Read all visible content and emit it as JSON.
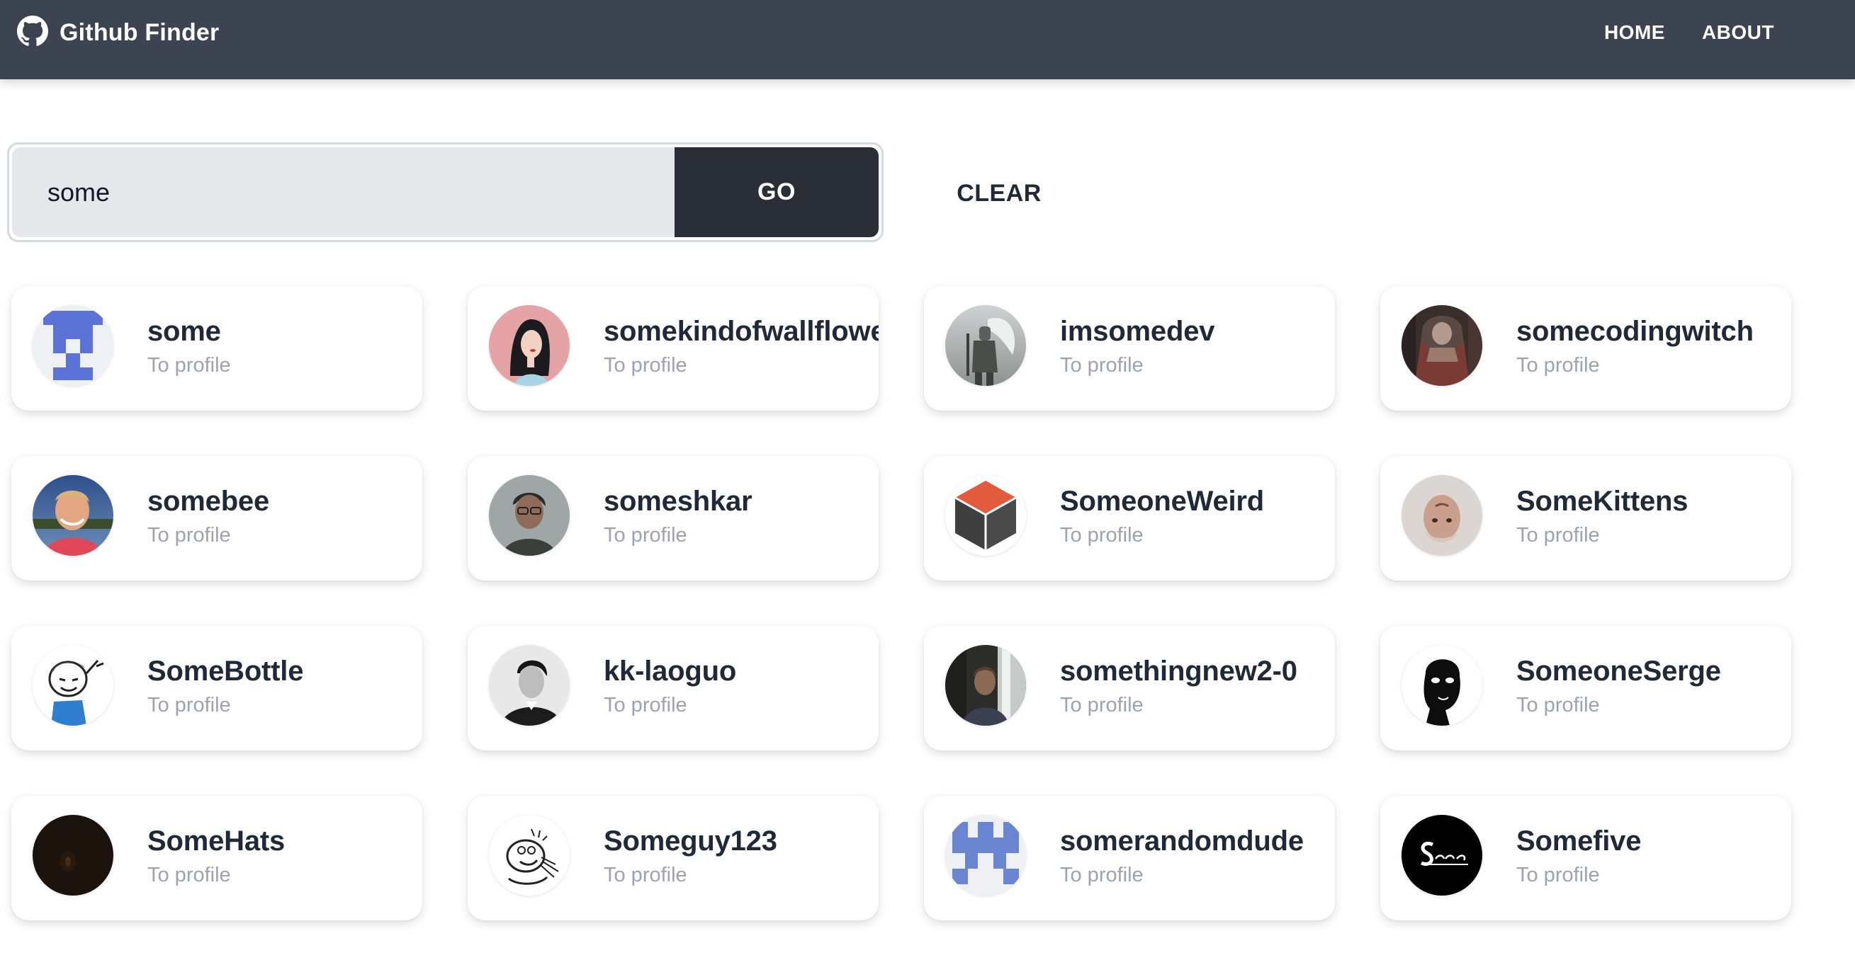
{
  "navbar": {
    "title": "Github Finder",
    "logo_icon": "github-icon",
    "links": [
      {
        "label": "HOME"
      },
      {
        "label": "ABOUT"
      }
    ],
    "background": "#3d4451"
  },
  "search": {
    "value": "some",
    "go_label": "GO",
    "clear_label": "CLEAR"
  },
  "results": [
    {
      "login": "some",
      "link": "To profile",
      "avatar": "identicon-blue"
    },
    {
      "login": "somekindofwallflower",
      "link": "To profile",
      "avatar": "illustrated-woman"
    },
    {
      "login": "imsomedev",
      "link": "To profile",
      "avatar": "knight-photo"
    },
    {
      "login": "somecodingwitch",
      "link": "To profile",
      "avatar": "figure-photo"
    },
    {
      "login": "somebee",
      "link": "To profile",
      "avatar": "smiling-man-photo"
    },
    {
      "login": "someshkar",
      "link": "To profile",
      "avatar": "man-glasses-photo"
    },
    {
      "login": "SomeoneWeird",
      "link": "To profile",
      "avatar": "cube-logo"
    },
    {
      "login": "SomeKittens",
      "link": "To profile",
      "avatar": "upside-down-face-photo"
    },
    {
      "login": "SomeBottle",
      "link": "To profile",
      "avatar": "cartoon-character"
    },
    {
      "login": "kk-laoguo",
      "link": "To profile",
      "avatar": "bw-portrait-photo"
    },
    {
      "login": "somethingnew2-0",
      "link": "To profile",
      "avatar": "waterfall-man-photo"
    },
    {
      "login": "SomeoneSerge",
      "link": "To profile",
      "avatar": "black-silhouette-face"
    },
    {
      "login": "SomeHats",
      "link": "To profile",
      "avatar": "dark-photo"
    },
    {
      "login": "Someguy123",
      "link": "To profile",
      "avatar": "rage-comic-face"
    },
    {
      "login": "somerandomdude",
      "link": "To profile",
      "avatar": "identicon-blue-pattern"
    },
    {
      "login": "Somefive",
      "link": "To profile",
      "avatar": "somefive-logo"
    }
  ]
}
